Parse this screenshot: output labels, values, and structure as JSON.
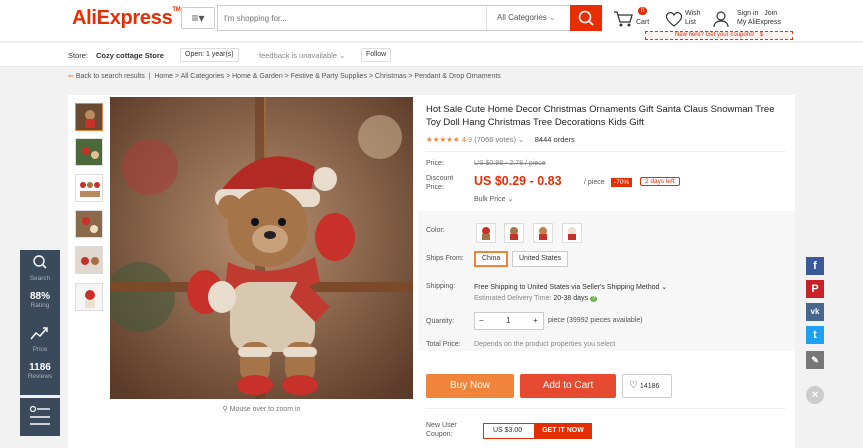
{
  "header": {
    "logo": "AliExpress",
    "logo_tm": "TM",
    "search_placeholder": "I'm shopping for...",
    "category": "All Categories",
    "cart_count": "0",
    "cart_label": "Cart",
    "wish_label_1": "Wish",
    "wish_label_2": "List",
    "signin": "Sign in",
    "join": "Join",
    "my_aliexpress": "My AliExpress",
    "coupon_banner": "New here? Get your coupons!",
    "coupon_amount": "$"
  },
  "store": {
    "label": "Store:",
    "name": "Cozy cottage Store",
    "open": "Open: 1 year(s)",
    "feedback": "feedback is unavailable",
    "follow": "Follow"
  },
  "breadcrumb": {
    "back": "Back to search results",
    "path": "Home > All Categories > Home & Garden > Festive & Party Supplies > Christmas > Pendant & Drop Ornaments"
  },
  "product": {
    "title": "Hot Sale Cute Home Decor Christmas Ornaments Gift Santa Claus Snowman Tree Toy Doll Hang Christmas Tree Decorations Kids Gift",
    "stars": "★★★★★",
    "rating": "4.9",
    "votes": "(7066 votes)",
    "orders": "8444 orders",
    "price_label": "Price:",
    "orig_price": "US $0.98 - 2.78 / piece",
    "discount_label_1": "Discount",
    "discount_label_2": "Price:",
    "discount_price": "US $0.29 - 0.83",
    "per_piece": "/ piece",
    "discount_pct": "-70%",
    "days_left": "2 days left",
    "bulk_price": "Bulk Price",
    "color_label": "Color:",
    "ships_label": "Ships From:",
    "ship_from_options": [
      "China",
      "United States"
    ],
    "shipping_label": "Shipping:",
    "shipping_text": "Free Shipping to United States via Seller's Shipping Method",
    "delivery_label": "Estimated Delivery Time:",
    "delivery_value": "20-38 days",
    "qty_label": "Quantity:",
    "qty_minus": "−",
    "qty_value": "1",
    "qty_plus": "+",
    "qty_available": "piece (39992 pieces available)",
    "total_label": "Total Price:",
    "total_text": "Depends on the product properties you select",
    "buy_now": "Buy Now",
    "add_to_cart": "Add to Cart",
    "wish_count": "14186",
    "new_user_1": "New User",
    "new_user_2": "Coupon:",
    "coupon_value": "US $3.00",
    "get_it_now": "GET IT NOW",
    "zoom_hint": "Mouse over to zoom in"
  },
  "left_float": {
    "search": "Search",
    "rating_value": "88%",
    "rating_label": "Rating",
    "price_label": "Price",
    "reviews_value": "1186",
    "reviews_label": "Reviews"
  },
  "social": [
    "f",
    "P",
    "vk",
    "t",
    "✎",
    "×"
  ],
  "colors": {
    "brand": "#e62e04",
    "buy_now": "#f0843a",
    "add_to_cart": "#e64b32",
    "sidebar": "#3a4a5c"
  }
}
